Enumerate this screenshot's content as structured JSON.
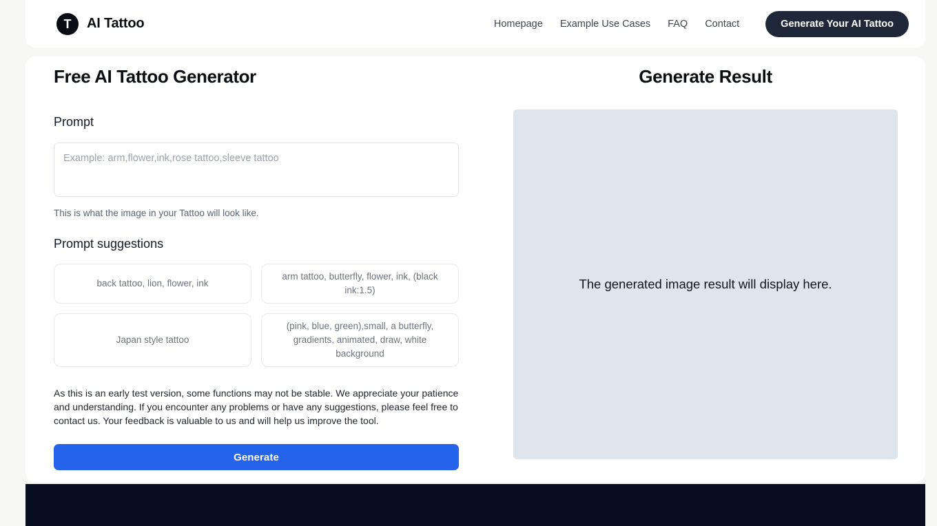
{
  "header": {
    "logo_letter": "T",
    "logo_icon": "circle-t-logo-icon",
    "brand_name": "AI Tattoo",
    "nav": [
      {
        "label": "Homepage"
      },
      {
        "label": "Example Use Cases"
      },
      {
        "label": "FAQ"
      },
      {
        "label": "Contact"
      }
    ],
    "cta_label": "Generate Your AI Tattoo"
  },
  "left_panel": {
    "title": "Free AI Tattoo Generator",
    "prompt_label": "Prompt",
    "prompt_value": "",
    "prompt_placeholder": "Example: arm,flower,ink,rose tattoo,sleeve tattoo",
    "helper_text": "This is what the image in your Tattoo will look like.",
    "suggestions_label": "Prompt suggestions",
    "suggestions": [
      "back tattoo, lion, flower, ink",
      "arm tattoo, butterfly, flower, ink, (black ink:1.5)",
      "Japan style tattoo",
      "(pink, blue, green),small, a butterfly, gradients, animated, draw, white background"
    ],
    "disclaimer": "As this is an early test version, some functions may not be stable. We appreciate your patience and understanding. If you encounter any problems or have any suggestions, please feel free to contact us. Your feedback is valuable to us and will help us improve the tool.",
    "generate_label": "Generate"
  },
  "right_panel": {
    "title": "Generate Result",
    "placeholder_text": "The generated image result will display here."
  },
  "colors": {
    "page_background": "#f7f7f6",
    "card_background": "#ffffff",
    "accent_blue": "#2563eb",
    "cta_dark": "#1e2838",
    "result_background": "#dfe5ed",
    "footer_background": "#090e20"
  }
}
